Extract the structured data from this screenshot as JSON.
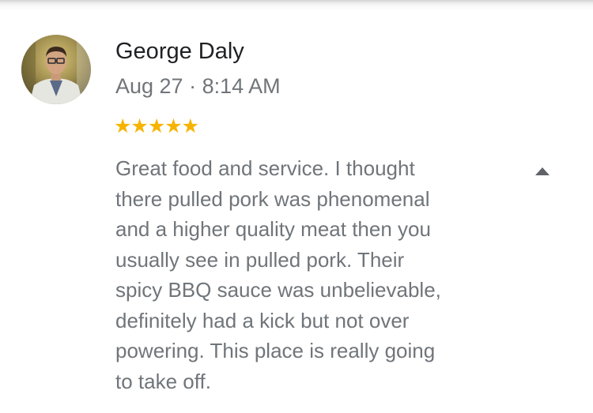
{
  "review": {
    "author_name": "George Daly",
    "date": "Aug 27",
    "separator": "·",
    "time": "8:14 AM",
    "rating": 5,
    "rating_max": 5,
    "stars_text": "★★★★★",
    "text": "Great food and service. I thought\nthere pulled pork was phenomenal\nand  a higher quality meat then you\nusually  see in pulled pork.  Their\nspicy BBQ sauce was unbelievable,\ndefinitely had a kick but not over\npowering.  This place is really going\nto take off."
  },
  "icons": {
    "avatar": "profile-photo",
    "collapse": "caret-up-icon"
  },
  "colors": {
    "name": "#202124",
    "secondary_text": "#70757a",
    "star": "#f6b400",
    "caret": "#5f6368"
  }
}
